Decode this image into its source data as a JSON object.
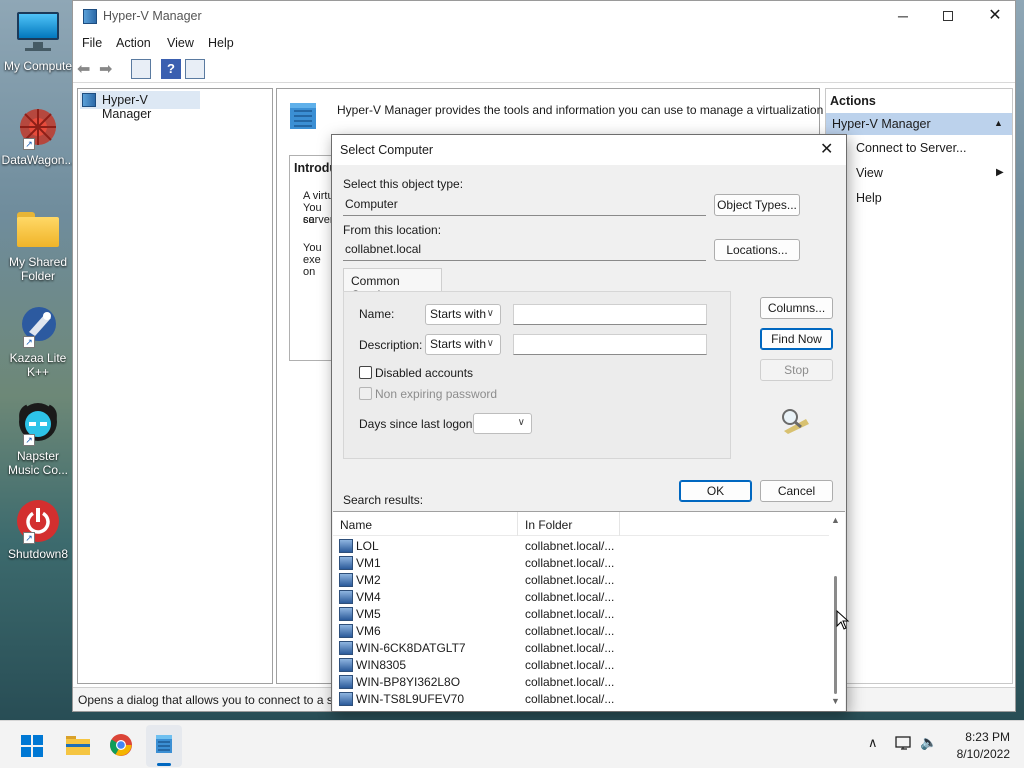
{
  "desktop": {
    "icons": [
      {
        "label": "My Compute",
        "icon": "monitor-icon"
      },
      {
        "label": "DataWagon...",
        "icon": "datawagon-icon"
      },
      {
        "label": "My Shared Folder",
        "icon": "folder-icon"
      },
      {
        "label": "Kazaa Lite K++",
        "icon": "kazaa-icon"
      },
      {
        "label": "Napster Music Co...",
        "icon": "napster-icon"
      },
      {
        "label": "Shutdown8",
        "icon": "power-icon"
      }
    ]
  },
  "window": {
    "title": "Hyper-V Manager",
    "menu": [
      "File",
      "Action",
      "View",
      "Help"
    ],
    "tree_root": "Hyper-V Manager",
    "center": {
      "banner_text": "Hyper-V Manager provides the tools and information you can use to manage a virtualization server.",
      "intro_heading": "Introdu",
      "intro_lines": [
        "A virtu",
        "You ca",
        "server.",
        "You",
        "exe",
        "on"
      ]
    },
    "actions": {
      "header": "Actions",
      "section": "Hyper-V Manager",
      "items": [
        "Connect to Server...",
        "View",
        "Help"
      ]
    },
    "status_text": "Opens a dialog that allows you to connect to a s"
  },
  "dialog": {
    "title": "Select Computer",
    "object_type_label": "Select this object type:",
    "object_type_value": "Computer",
    "object_types_button": "Object Types...",
    "location_label": "From this location:",
    "location_value": "collabnet.local",
    "locations_button": "Locations...",
    "tab_label": "Common Queries",
    "name_label": "Name:",
    "name_mode": "Starts with",
    "description_label": "Description:",
    "description_mode": "Starts with",
    "disabled_accounts": "Disabled accounts",
    "non_expiring_password": "Non expiring password",
    "days_label": "Days since last logon:",
    "columns_button": "Columns...",
    "find_now_button": "Find Now",
    "stop_button": "Stop",
    "ok_button": "OK",
    "cancel_button": "Cancel",
    "search_results_label": "Search results:",
    "columns": [
      "Name",
      "In Folder"
    ],
    "results": [
      {
        "name": "LOL",
        "folder": "collabnet.local/..."
      },
      {
        "name": "VM1",
        "folder": "collabnet.local/..."
      },
      {
        "name": "VM2",
        "folder": "collabnet.local/..."
      },
      {
        "name": "VM4",
        "folder": "collabnet.local/..."
      },
      {
        "name": "VM5",
        "folder": "collabnet.local/..."
      },
      {
        "name": "VM6",
        "folder": "collabnet.local/..."
      },
      {
        "name": "WIN-6CK8DATGLT7",
        "folder": "collabnet.local/..."
      },
      {
        "name": "WIN8305",
        "folder": "collabnet.local/..."
      },
      {
        "name": "WIN-BP8YI362L8O",
        "folder": "collabnet.local/..."
      },
      {
        "name": "WIN-TS8L9UFEV70",
        "folder": "collabnet.local/..."
      }
    ]
  },
  "taskbar": {
    "time": "8:23 PM",
    "date": "8/10/2022"
  },
  "colors": {
    "accent": "#0067c0",
    "actions_section_bg": "#bcd2ec"
  }
}
